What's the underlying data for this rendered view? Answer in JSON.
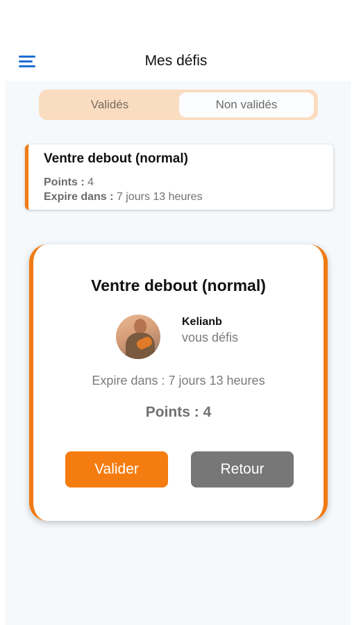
{
  "header": {
    "title": "Mes défis",
    "menu_icon": "menu-icon"
  },
  "tabs": [
    {
      "label": "Validés",
      "selected": false
    },
    {
      "label": "Non validés",
      "selected": true
    }
  ],
  "list": [
    {
      "title": "Ventre debout (normal)",
      "points_label": "Points :",
      "points_value": "4",
      "expire_label": "Expire dans :",
      "expire_value": "7 jours 13 heures"
    }
  ],
  "modal": {
    "title": "Ventre debout (normal)",
    "username": "Kelianb",
    "subtitle": "vous défis",
    "expire": "Expire dans : 7 jours 13 heures",
    "points": "Points : 4",
    "validate_label": "Valider",
    "back_label": "Retour"
  },
  "colors": {
    "accent": "#f57c10",
    "segment_bg": "#fadcc1",
    "back_button": "#777777",
    "menu_icon": "#1f6fd1"
  }
}
